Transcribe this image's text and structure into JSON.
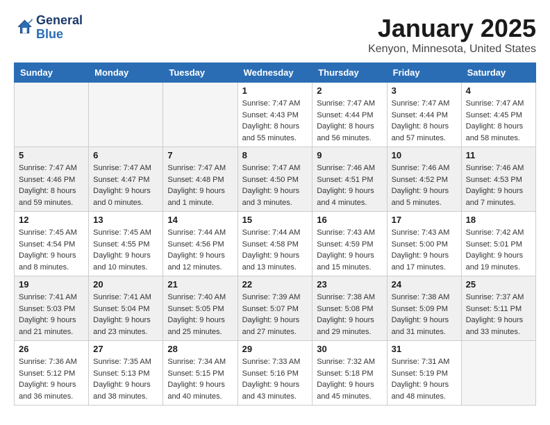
{
  "logo": {
    "line1": "General",
    "line2": "Blue"
  },
  "title": "January 2025",
  "location": "Kenyon, Minnesota, United States",
  "weekdays": [
    "Sunday",
    "Monday",
    "Tuesday",
    "Wednesday",
    "Thursday",
    "Friday",
    "Saturday"
  ],
  "weeks": [
    [
      {
        "day": "",
        "info": ""
      },
      {
        "day": "",
        "info": ""
      },
      {
        "day": "",
        "info": ""
      },
      {
        "day": "1",
        "info": "Sunrise: 7:47 AM\nSunset: 4:43 PM\nDaylight: 8 hours\nand 55 minutes."
      },
      {
        "day": "2",
        "info": "Sunrise: 7:47 AM\nSunset: 4:44 PM\nDaylight: 8 hours\nand 56 minutes."
      },
      {
        "day": "3",
        "info": "Sunrise: 7:47 AM\nSunset: 4:44 PM\nDaylight: 8 hours\nand 57 minutes."
      },
      {
        "day": "4",
        "info": "Sunrise: 7:47 AM\nSunset: 4:45 PM\nDaylight: 8 hours\nand 58 minutes."
      }
    ],
    [
      {
        "day": "5",
        "info": "Sunrise: 7:47 AM\nSunset: 4:46 PM\nDaylight: 8 hours\nand 59 minutes."
      },
      {
        "day": "6",
        "info": "Sunrise: 7:47 AM\nSunset: 4:47 PM\nDaylight: 9 hours\nand 0 minutes."
      },
      {
        "day": "7",
        "info": "Sunrise: 7:47 AM\nSunset: 4:48 PM\nDaylight: 9 hours\nand 1 minute."
      },
      {
        "day": "8",
        "info": "Sunrise: 7:47 AM\nSunset: 4:50 PM\nDaylight: 9 hours\nand 3 minutes."
      },
      {
        "day": "9",
        "info": "Sunrise: 7:46 AM\nSunset: 4:51 PM\nDaylight: 9 hours\nand 4 minutes."
      },
      {
        "day": "10",
        "info": "Sunrise: 7:46 AM\nSunset: 4:52 PM\nDaylight: 9 hours\nand 5 minutes."
      },
      {
        "day": "11",
        "info": "Sunrise: 7:46 AM\nSunset: 4:53 PM\nDaylight: 9 hours\nand 7 minutes."
      }
    ],
    [
      {
        "day": "12",
        "info": "Sunrise: 7:45 AM\nSunset: 4:54 PM\nDaylight: 9 hours\nand 8 minutes."
      },
      {
        "day": "13",
        "info": "Sunrise: 7:45 AM\nSunset: 4:55 PM\nDaylight: 9 hours\nand 10 minutes."
      },
      {
        "day": "14",
        "info": "Sunrise: 7:44 AM\nSunset: 4:56 PM\nDaylight: 9 hours\nand 12 minutes."
      },
      {
        "day": "15",
        "info": "Sunrise: 7:44 AM\nSunset: 4:58 PM\nDaylight: 9 hours\nand 13 minutes."
      },
      {
        "day": "16",
        "info": "Sunrise: 7:43 AM\nSunset: 4:59 PM\nDaylight: 9 hours\nand 15 minutes."
      },
      {
        "day": "17",
        "info": "Sunrise: 7:43 AM\nSunset: 5:00 PM\nDaylight: 9 hours\nand 17 minutes."
      },
      {
        "day": "18",
        "info": "Sunrise: 7:42 AM\nSunset: 5:01 PM\nDaylight: 9 hours\nand 19 minutes."
      }
    ],
    [
      {
        "day": "19",
        "info": "Sunrise: 7:41 AM\nSunset: 5:03 PM\nDaylight: 9 hours\nand 21 minutes."
      },
      {
        "day": "20",
        "info": "Sunrise: 7:41 AM\nSunset: 5:04 PM\nDaylight: 9 hours\nand 23 minutes."
      },
      {
        "day": "21",
        "info": "Sunrise: 7:40 AM\nSunset: 5:05 PM\nDaylight: 9 hours\nand 25 minutes."
      },
      {
        "day": "22",
        "info": "Sunrise: 7:39 AM\nSunset: 5:07 PM\nDaylight: 9 hours\nand 27 minutes."
      },
      {
        "day": "23",
        "info": "Sunrise: 7:38 AM\nSunset: 5:08 PM\nDaylight: 9 hours\nand 29 minutes."
      },
      {
        "day": "24",
        "info": "Sunrise: 7:38 AM\nSunset: 5:09 PM\nDaylight: 9 hours\nand 31 minutes."
      },
      {
        "day": "25",
        "info": "Sunrise: 7:37 AM\nSunset: 5:11 PM\nDaylight: 9 hours\nand 33 minutes."
      }
    ],
    [
      {
        "day": "26",
        "info": "Sunrise: 7:36 AM\nSunset: 5:12 PM\nDaylight: 9 hours\nand 36 minutes."
      },
      {
        "day": "27",
        "info": "Sunrise: 7:35 AM\nSunset: 5:13 PM\nDaylight: 9 hours\nand 38 minutes."
      },
      {
        "day": "28",
        "info": "Sunrise: 7:34 AM\nSunset: 5:15 PM\nDaylight: 9 hours\nand 40 minutes."
      },
      {
        "day": "29",
        "info": "Sunrise: 7:33 AM\nSunset: 5:16 PM\nDaylight: 9 hours\nand 43 minutes."
      },
      {
        "day": "30",
        "info": "Sunrise: 7:32 AM\nSunset: 5:18 PM\nDaylight: 9 hours\nand 45 minutes."
      },
      {
        "day": "31",
        "info": "Sunrise: 7:31 AM\nSunset: 5:19 PM\nDaylight: 9 hours\nand 48 minutes."
      },
      {
        "day": "",
        "info": ""
      }
    ]
  ]
}
